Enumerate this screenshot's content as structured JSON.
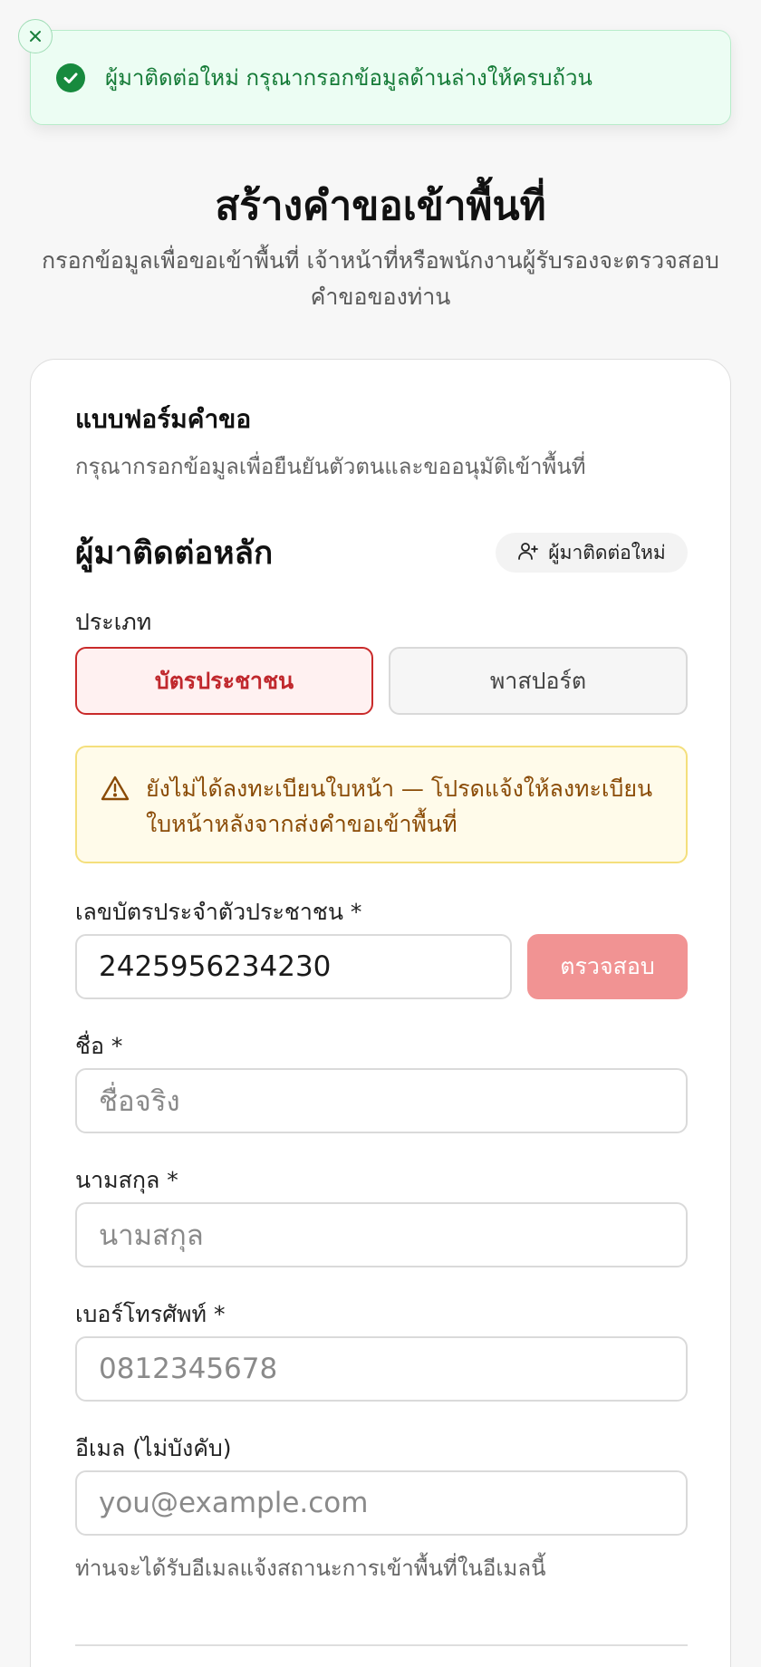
{
  "toast": {
    "message": "ผู้มาติดต่อใหม่ กรุณากรอกข้อมูลด้านล่างให้ครบถ้วน",
    "close_icon": "close-icon",
    "status_icon": "check-circle-icon",
    "accent": "#178a3e"
  },
  "header": {
    "title": "สร้างคำขอเข้าพื้นที่",
    "subtitle_line1": "กรอกข้อมูลเพื่อขอเข้าพื้นที่ เจ้าหน้าที่หรือพนักงานผู้รับรองจะตรวจสอบ",
    "subtitle_line2": "คำขอของท่าน"
  },
  "form": {
    "title": "แบบฟอร์มคำขอ",
    "description": "กรุณากรอกข้อมูลเพื่อยืนยันตัวตนและขออนุมัติเข้าพื้นที่",
    "section_title": "ผู้มาติดต่อหลัก",
    "new_contact_label": "ผู้มาติดต่อใหม่",
    "type_label": "ประเภท",
    "type_options": [
      "บัตรประชาชน",
      "พาสปอร์ต"
    ],
    "type_selected": "บัตรประชาชน",
    "alert_line1": "ยังไม่ได้ลงทะเบียนใบหน้า — โปรดแจ้งให้ลงทะเบียน",
    "alert_line2": "ใบหน้าหลังจากส่งคำขอเข้าพื้นที่",
    "id_label": "เลขบัตรประจำตัวประชาชน *",
    "id_value": "2425956234230",
    "verify_label": "ตรวจสอบ",
    "first_name_label": "ชื่อ *",
    "first_name_placeholder": "ชื่อจริง",
    "last_name_label": "นามสกุล *",
    "last_name_placeholder": "นามสกุล",
    "phone_label": "เบอร์โทรศัพท์ *",
    "phone_placeholder": "0812345678",
    "email_label": "อีเมล (ไม่บังคับ)",
    "email_placeholder": "you@example.com",
    "email_help": "ท่านจะได้รับอีเมลแจ้งสถานะการเข้าพื้นที่ในอีเมลนี้"
  },
  "colors": {
    "primary_red": "#c92a2a",
    "verify_button": "#f19393",
    "warning_text": "#8a4b06",
    "warning_bg": "#fffbea"
  }
}
